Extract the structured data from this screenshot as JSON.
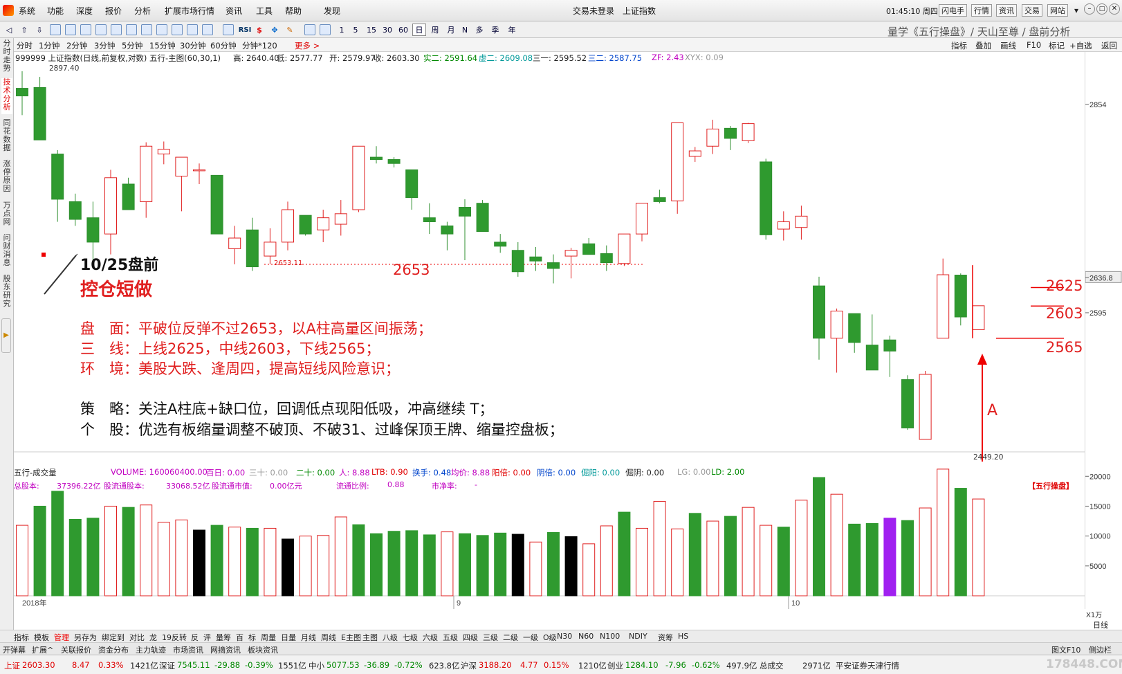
{
  "menu": {
    "items": [
      "系统",
      "功能",
      "深度",
      "报价",
      "分析",
      "扩展市场行情",
      "资讯",
      "工具",
      "帮助",
      "发现"
    ],
    "status_login": "交易未登录",
    "status_index": "上证指数",
    "time": "01:45:10 周四",
    "quick": [
      "闪电手",
      "行情",
      "资讯",
      "交易",
      "网站"
    ]
  },
  "toolbar": {
    "periods": [
      "1",
      "5",
      "15",
      "30",
      "60",
      "日",
      "周",
      "月",
      "N",
      "多",
      "季",
      "年"
    ],
    "brand": "量学《五行操盘》/ 天山至尊 / 盘前分析",
    "rsi": "RSI"
  },
  "periodbar": {
    "items": [
      "分时",
      "1分钟",
      "2分钟",
      "3分钟",
      "5分钟",
      "15分钟",
      "30分钟",
      "60分钟",
      "分钟*120",
      "更多 >"
    ],
    "right": [
      "指标",
      "叠加",
      "画线",
      "F10",
      "标记",
      "+自选",
      "返回"
    ]
  },
  "lefttabs": [
    "分时走势",
    "技术分析",
    "同花数据",
    "涨停原因",
    "万点网",
    "问财消息",
    "股东研究"
  ],
  "info": {
    "code": "999999 上证指数(日线,前复权,对数) 五行-主图(60,30,1)",
    "high": "高: 2640.40",
    "low": "低: 2577.77",
    "open": "开: 2579.97",
    "close": "收: 2603.30",
    "s2": "实二: 2591.64",
    "x2": "虚二: 2609.08",
    "sy": "三一: 2595.52",
    "se": "三二: 2587.75",
    "zf": "ZF: 2.43",
    "xyx": "XYX: 0.09"
  },
  "vol_info": {
    "name": "五行-成交量",
    "volume": "VOLUME: 160060400.00",
    "bai": "百日: 0.00",
    "san": "三十: 0.00",
    "er": "二十: 0.00",
    "ren": "人: 8.88",
    "ltb": "LTB: 0.90",
    "hs": "换手: 0.48",
    "jj": "均价: 8.88",
    "yb": "阳倍: 0.00",
    "yinb": "阴倍: 0.00",
    "jy": "倔阳: 0.00",
    "jq": "倔阴: 0.00",
    "lg": "LG: 0.00",
    "ld": "LD: 2.00"
  },
  "vol_info2": {
    "zgb": "总股本:",
    "zgb_v": "37396.22亿",
    "ltgb": "股流通股本:",
    "ltgb_v": "33068.52亿",
    "ltsz": "股流通市值:",
    "ltsz_v": "0.00亿元",
    "ltbl": "流通比例:",
    "ltbl_v": "0.88",
    "sjl": "市净率:",
    "sjl_v": "-",
    "tag": "【五行操盘】"
  },
  "annotations": {
    "date": "10/25盘前",
    "headline": "控仓短做",
    "line1": "盘　面：平破位反弹不过2653，以A柱高量区间振荡；",
    "line2": "三　线：上线2625，中线2603，下线2565；",
    "line3": "环　境：美股大跌、逢周四，提高短线风险意识；",
    "line4": "策　略：关注A柱底+缺口位，回调低点现阳低吸，冲高继续 T；",
    "line5": "个　股：优选有板缩量调整不破顶、不破31、过峰保顶王牌、缩量控盘板；",
    "lvl2653": "2653",
    "lvl2625": "2625",
    "lvl2603": "2603",
    "lvl2565": "2565",
    "mark_a": "A",
    "hi_label": "2897.40",
    "lo_label": "2449.20",
    "support_label": "2653.11"
  },
  "axis": {
    "price": [
      "2854",
      "2636.8",
      "2595"
    ],
    "vol": [
      "20000",
      "15000",
      "10000",
      "5000"
    ],
    "unit": "X1万",
    "months": [
      "2018年",
      "9",
      "10"
    ]
  },
  "bottomtabs": [
    "指标",
    "模板",
    "管理",
    "另存为",
    "绑定到",
    "对比",
    "龙",
    "19反转",
    "反",
    "评",
    "量筹",
    "百",
    "标",
    "周量",
    "日量",
    "月线",
    "周线",
    "E主图",
    "主图",
    "八级",
    "七级",
    "六级",
    "五级",
    "四级",
    "三级",
    "二级",
    "一级",
    "O级",
    "N30",
    "N60",
    "N100",
    "NDIY",
    "资筹",
    "HS"
  ],
  "bottom_right": [
    "日线",
    "图文F10",
    "侧边栏"
  ],
  "subtabs": [
    "开弹幕",
    "扩展^",
    "关联报价",
    "资金分布",
    "主力轨迹",
    "市场资讯",
    "网摘资讯",
    "板块资讯"
  ],
  "statusbar": {
    "sh": "上证",
    "sh_p": "2603.30",
    "sh_c": "8.47",
    "sh_pct": "0.33%",
    "sh_amt": "1421亿",
    "sz": "深证",
    "sz_p": "7545.11",
    "sz_c": "-29.88",
    "sz_pct": "-0.39%",
    "sz_amt": "1551亿",
    "zx": "中小",
    "zx_p": "5077.53",
    "zx_c": "-36.89",
    "zx_pct": "-0.72%",
    "zx_amt": "623.8亿",
    "hs": "沪深",
    "hs_p": "3188.20",
    "hs_c": "4.77",
    "hs_pct": "0.15%",
    "hs_amt": "1210亿",
    "cy": "创业",
    "cy_p": "1284.10",
    "cy_c": "-7.96",
    "cy_pct": "-0.62%",
    "cy_amt": "497.9亿",
    "total": "总成交",
    "total_v": "2971亿",
    "broker": "平安证券天津行情",
    "watermark": "178448.COM"
  },
  "chart_data": {
    "type": "candlestick",
    "candles": [
      {
        "o": 2875,
        "h": 2897.4,
        "l": 2840,
        "c": 2865
      },
      {
        "o": 2876,
        "h": 2890,
        "l": 2825,
        "c": 2808
      },
      {
        "o": 2790,
        "h": 2795,
        "l": 2705,
        "c": 2733
      },
      {
        "o": 2730,
        "h": 2740,
        "l": 2700,
        "c": 2708
      },
      {
        "o": 2710,
        "h": 2730,
        "l": 2655,
        "c": 2680
      },
      {
        "o": 2690,
        "h": 2770,
        "l": 2665,
        "c": 2760
      },
      {
        "o": 2752,
        "h": 2760,
        "l": 2720,
        "c": 2720
      },
      {
        "o": 2730,
        "h": 2805,
        "l": 2710,
        "c": 2800
      },
      {
        "o": 2790,
        "h": 2806,
        "l": 2777,
        "c": 2796
      },
      {
        "o": 2762,
        "h": 2786,
        "l": 2718,
        "c": 2786
      },
      {
        "o": 2770,
        "h": 2778,
        "l": 2752,
        "c": 2770
      },
      {
        "o": 2763,
        "h": 2763,
        "l": 2690,
        "c": 2690
      },
      {
        "o": 2672,
        "h": 2700,
        "l": 2653,
        "c": 2685
      },
      {
        "o": 2695,
        "h": 2710,
        "l": 2645,
        "c": 2650
      },
      {
        "o": 2663,
        "h": 2697,
        "l": 2653,
        "c": 2680
      },
      {
        "o": 2680,
        "h": 2730,
        "l": 2670,
        "c": 2720
      },
      {
        "o": 2713,
        "h": 2713,
        "l": 2688,
        "c": 2690
      },
      {
        "o": 2695,
        "h": 2720,
        "l": 2680,
        "c": 2710
      },
      {
        "o": 2702,
        "h": 2732,
        "l": 2688,
        "c": 2715
      },
      {
        "o": 2720,
        "h": 2800,
        "l": 2717,
        "c": 2800
      },
      {
        "o": 2786,
        "h": 2800,
        "l": 2778,
        "c": 2783
      },
      {
        "o": 2783,
        "h": 2786,
        "l": 2773,
        "c": 2778
      },
      {
        "o": 2770,
        "h": 2770,
        "l": 2720,
        "c": 2735
      },
      {
        "o": 2710,
        "h": 2728,
        "l": 2690,
        "c": 2705
      },
      {
        "o": 2700,
        "h": 2705,
        "l": 2670,
        "c": 2690
      },
      {
        "o": 2723,
        "h": 2733,
        "l": 2658,
        "c": 2712
      },
      {
        "o": 2728,
        "h": 2732,
        "l": 2700,
        "c": 2693
      },
      {
        "o": 2680,
        "h": 2690,
        "l": 2667,
        "c": 2675
      },
      {
        "o": 2670,
        "h": 2680,
        "l": 2638,
        "c": 2644
      },
      {
        "o": 2662,
        "h": 2674,
        "l": 2645,
        "c": 2657
      },
      {
        "o": 2655,
        "h": 2665,
        "l": 2630,
        "c": 2648
      },
      {
        "o": 2663,
        "h": 2673,
        "l": 2636,
        "c": 2670
      },
      {
        "o": 2678,
        "h": 2685,
        "l": 2665,
        "c": 2665
      },
      {
        "o": 2666,
        "h": 2676,
        "l": 2645,
        "c": 2655
      },
      {
        "o": 2654,
        "h": 2688,
        "l": 2651,
        "c": 2690
      },
      {
        "o": 2690,
        "h": 2723,
        "l": 2681,
        "c": 2728
      },
      {
        "o": 2735,
        "h": 2745,
        "l": 2728,
        "c": 2730
      },
      {
        "o": 2731,
        "h": 2830,
        "l": 2715,
        "c": 2830
      },
      {
        "o": 2787,
        "h": 2799,
        "l": 2780,
        "c": 2794
      },
      {
        "o": 2800,
        "h": 2834,
        "l": 2790,
        "c": 2822
      },
      {
        "o": 2823,
        "h": 2826,
        "l": 2795,
        "c": 2810
      },
      {
        "o": 2807,
        "h": 2830,
        "l": 2804,
        "c": 2829
      },
      {
        "o": 2780,
        "h": 2784,
        "l": 2683,
        "c": 2689
      },
      {
        "o": 2696,
        "h": 2718,
        "l": 2682,
        "c": 2705
      },
      {
        "o": 2698,
        "h": 2725,
        "l": 2683,
        "c": 2712
      },
      {
        "o": 2627,
        "h": 2638,
        "l": 2540,
        "c": 2565
      },
      {
        "o": 2565,
        "h": 2600,
        "l": 2525,
        "c": 2597
      },
      {
        "o": 2594,
        "h": 2594,
        "l": 2548,
        "c": 2560
      },
      {
        "o": 2557,
        "h": 2593,
        "l": 2530,
        "c": 2528
      },
      {
        "o": 2563,
        "h": 2568,
        "l": 2520,
        "c": 2550
      },
      {
        "o": 2517,
        "h": 2522,
        "l": 2460,
        "c": 2462
      },
      {
        "o": 2449.2,
        "h": 2527,
        "l": 2449.2,
        "c": 2523
      },
      {
        "o": 2565,
        "h": 2660,
        "l": 2565,
        "c": 2640.4
      },
      {
        "o": 2640,
        "h": 2642,
        "l": 2580,
        "c": 2590
      },
      {
        "o": 2575,
        "h": 2600,
        "l": 2575,
        "c": 2603.3
      }
    ],
    "volumes": [
      11800,
      15000,
      17500,
      12800,
      13000,
      15000,
      14800,
      15200,
      12300,
      12700,
      11000,
      11800,
      11500,
      11300,
      11300,
      9500,
      10000,
      10100,
      13200,
      11900,
      10400,
      10800,
      10900,
      10200,
      10700,
      10400,
      10100,
      10500,
      10300,
      9000,
      10600,
      9900,
      8700,
      11700,
      14000,
      11300,
      15800,
      11200,
      13800,
      12500,
      13300,
      14800,
      11800,
      11500,
      16000,
      19800,
      17000,
      12000,
      12100,
      13000,
      12600,
      14700,
      21200,
      18000,
      16200
    ],
    "vol_colors": [
      "up",
      "down",
      "down",
      "down",
      "down",
      "up",
      "down",
      "up",
      "up",
      "up",
      "black",
      "down",
      "up",
      "down",
      "up",
      "black",
      "up",
      "up",
      "up",
      "down",
      "down",
      "down",
      "down",
      "down",
      "up",
      "down",
      "down",
      "down",
      "black",
      "up",
      "down",
      "black",
      "up",
      "up",
      "down",
      "up",
      "up",
      "up",
      "down",
      "up",
      "down",
      "up",
      "up",
      "down",
      "up",
      "down",
      "up",
      "down",
      "down",
      "purple",
      "down",
      "up",
      "up",
      "down",
      "up"
    ],
    "y_range": [
      2449.2,
      2897.4
    ],
    "vol_range": [
      0,
      22000
    ]
  }
}
